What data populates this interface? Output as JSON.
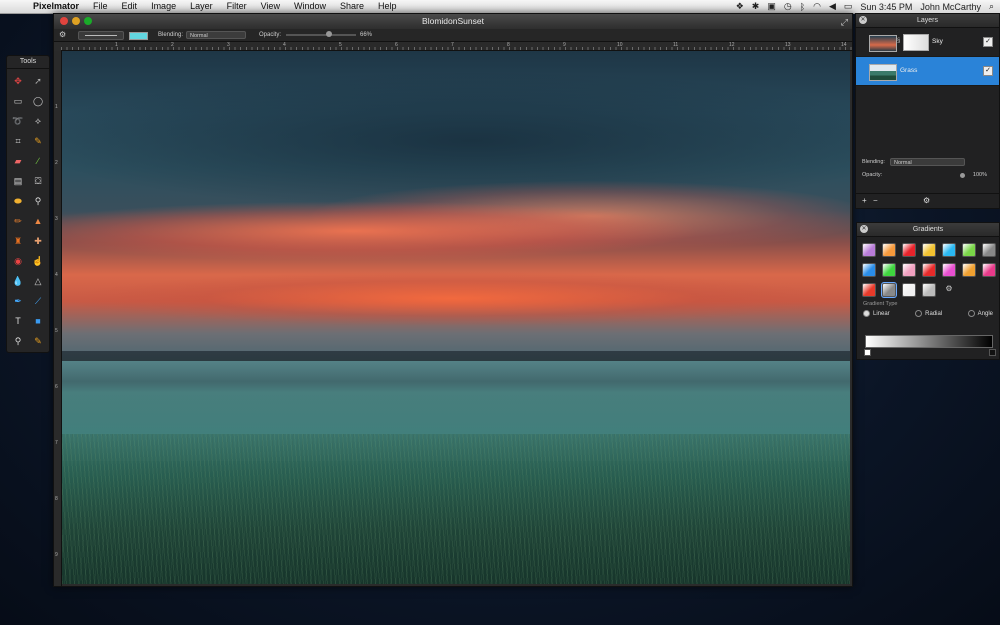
{
  "menubar": {
    "app_name": "Pixelmator",
    "menus": [
      "File",
      "Edit",
      "Image",
      "Layer",
      "Filter",
      "View",
      "Window",
      "Share",
      "Help"
    ],
    "clock": "Sun 3:45 PM",
    "user": "John McCarthy"
  },
  "document": {
    "title": "BlomidonSunset",
    "options": {
      "blending_label": "Blending:",
      "blending_value": "Normal",
      "opacity_label": "Opacity:",
      "opacity_value": "66%",
      "color": "#63d6e0"
    },
    "ruler_h": [
      "1",
      "2",
      "3",
      "4",
      "5",
      "6",
      "7",
      "8",
      "9",
      "10",
      "11",
      "12",
      "13",
      "14"
    ],
    "ruler_v": [
      "1",
      "2",
      "3",
      "4",
      "5",
      "6",
      "7",
      "8",
      "9"
    ]
  },
  "tools": {
    "title": "Tools",
    "items": [
      "move",
      "selection-arrow",
      "rect-select",
      "ellipse-select",
      "lasso",
      "polygon-lasso",
      "crop",
      "eyedropper",
      "eraser",
      "brush",
      "gradient",
      "paint-bucket",
      "sponge",
      "magic-wand",
      "pencil",
      "burn",
      "clone-stamp",
      "healing",
      "red-eye",
      "smudge",
      "blur",
      "sharpen",
      "pen",
      "line",
      "type",
      "shape",
      "zoom",
      "color-picker"
    ]
  },
  "layers": {
    "title": "Layers",
    "items": [
      {
        "name": "Sky",
        "visible": true,
        "selected": false
      },
      {
        "name": "Grass",
        "visible": true,
        "selected": true
      }
    ],
    "blending_label": "Blending:",
    "blending_value": "Normal",
    "opacity_label": "Opacity:",
    "opacity_value": "100%",
    "footer": {
      "add": "+",
      "remove": "−",
      "gear": "⚙"
    }
  },
  "gradients": {
    "title": "Gradients",
    "swatches": [
      "#b97cd8",
      "#f79a3c",
      "#e8232b",
      "#f2c230",
      "#2ab8f2",
      "#7ad648",
      "#888888",
      "#2a8de8",
      "#3fd63f",
      "#f0a0c0",
      "#e82a2a",
      "#e84fd0",
      "#f0a030",
      "#e83a8a",
      "#e83a2a",
      "#888888",
      "#f0f0f0",
      "#bbbbbb"
    ],
    "type_label": "Gradient Type",
    "types": [
      "Linear",
      "Radial",
      "Angle"
    ],
    "selected_type": "Linear"
  }
}
